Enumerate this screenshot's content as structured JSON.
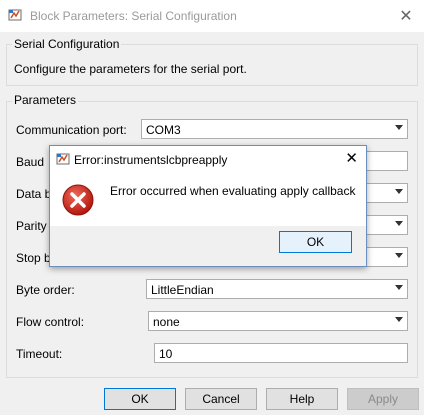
{
  "window": {
    "title": "Block Parameters: Serial Configuration",
    "close_glyph": "✕"
  },
  "section_block": {
    "label": "Serial Configuration",
    "description": "Configure the parameters for the serial port."
  },
  "section_params": {
    "label": "Parameters",
    "fields": {
      "communication_port": {
        "label": "Communication port:",
        "value": "COM3"
      },
      "baud_rate": {
        "label": "Baud",
        "value": ""
      },
      "data_bits": {
        "label": "Data b",
        "value": ""
      },
      "parity": {
        "label": "Parity",
        "value": ""
      },
      "stop_bits": {
        "label": "Stop b",
        "value": ""
      },
      "byte_order": {
        "label": "Byte order:",
        "value": "LittleEndian"
      },
      "flow_control": {
        "label": "Flow control:",
        "value": "none"
      },
      "timeout": {
        "label": "Timeout:",
        "value": "10"
      }
    }
  },
  "buttons": {
    "ok": "OK",
    "cancel": "Cancel",
    "help": "Help",
    "apply": "Apply"
  },
  "error_dialog": {
    "title": "Error:instrumentslcbpreapply",
    "message": "Error occurred when evaluating apply callback",
    "ok": "OK",
    "close_glyph": "✕",
    "icon": "error-x-icon"
  },
  "colors": {
    "accent": "#0078d7",
    "error": "#c42b1c"
  }
}
